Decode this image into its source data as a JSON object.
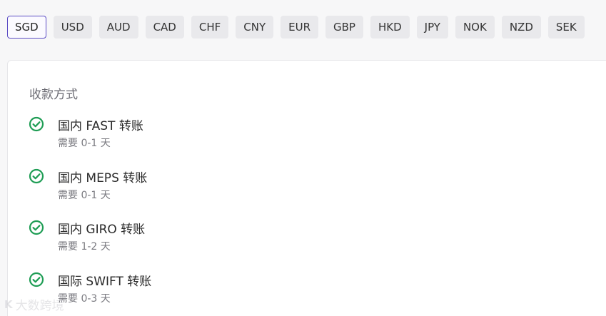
{
  "currency_tabs": [
    "SGD",
    "USD",
    "AUD",
    "CAD",
    "CHF",
    "CNY",
    "EUR",
    "GBP",
    "HKD",
    "JPY",
    "NOK",
    "NZD",
    "SEK"
  ],
  "active_currency": "SGD",
  "card": {
    "section_title": "收款方式",
    "methods": [
      {
        "name": "国内 FAST 转账",
        "desc": "需要 0-1 天"
      },
      {
        "name": "国内 MEPS 转账",
        "desc": "需要 0-1 天"
      },
      {
        "name": "国内 GIRO 转账",
        "desc": "需要 1-2 天"
      },
      {
        "name": "国际 SWIFT 转账",
        "desc": "需要 0-3 天"
      }
    ]
  },
  "watermark": {
    "logo": "K",
    "text": "大数跨境"
  },
  "colors": {
    "check_green": "#1f9d55",
    "active_border": "#5b4cc4"
  },
  "icons": {
    "method_status": "check-circle-icon"
  }
}
